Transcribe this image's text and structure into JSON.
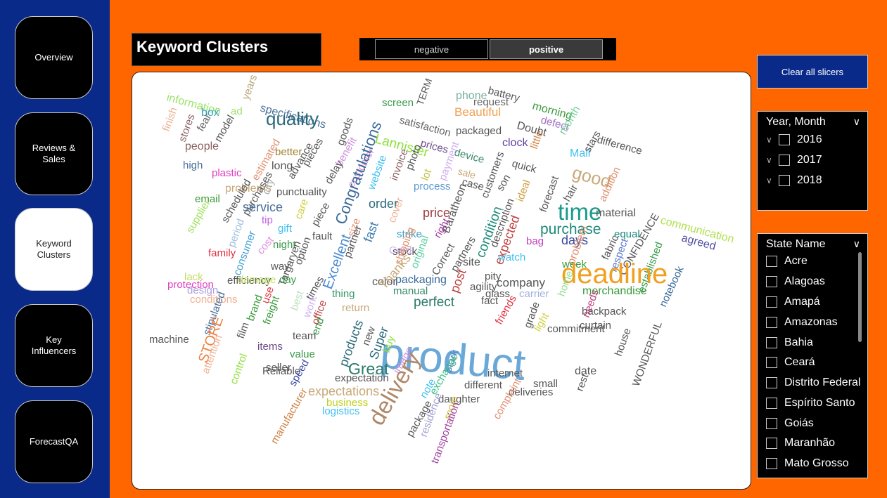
{
  "nav": [
    {
      "label": "Overview"
    },
    {
      "label": "Reviews &\nSales"
    },
    {
      "label": "Keyword\nClusters"
    },
    {
      "label": "Key\nInfluencers"
    },
    {
      "label": "ForecastQA"
    }
  ],
  "title": "Keyword Clusters",
  "sentiment": {
    "negative": "negative",
    "positive": "positive"
  },
  "clear_label": "Clear all slicers",
  "year_slicer": {
    "title": "Year, Month",
    "items": [
      "2016",
      "2017",
      "2018"
    ]
  },
  "state_slicer": {
    "title": "State Name",
    "items": [
      "Acre",
      "Alagoas",
      "Amapá",
      "Amazonas",
      "Bahia",
      "Ceará",
      "Distrito Federal",
      "Espírito Santo",
      "Goiás",
      "Maranhão",
      "Mato Grosso"
    ]
  },
  "word_cloud": [
    {
      "t": "information",
      "s": 16,
      "c": "#9be36b"
    },
    {
      "t": "ad",
      "s": 15,
      "c": "#9be36b"
    },
    {
      "t": "years",
      "s": 15,
      "c": "#b9a27a"
    },
    {
      "t": "specifications",
      "s": 16,
      "c": "#4a6f9a"
    },
    {
      "t": "screen",
      "s": 15,
      "c": "#3a9a4a"
    },
    {
      "t": "TERM",
      "s": 14,
      "c": "#555"
    },
    {
      "t": "phone",
      "s": 16,
      "c": "#7ab0a0"
    },
    {
      "t": "battery",
      "s": 15,
      "c": "#555"
    },
    {
      "t": "request",
      "s": 15,
      "c": "#666"
    },
    {
      "t": "morning",
      "s": 16,
      "c": "#3a9a3a"
    },
    {
      "t": "box",
      "s": 16,
      "c": "#3aa0c0"
    },
    {
      "t": "finish",
      "s": 15,
      "c": "#e8b090"
    },
    {
      "t": "stores",
      "s": 15,
      "c": "#8a6060"
    },
    {
      "t": "fear",
      "s": 15,
      "c": "#666"
    },
    {
      "t": "model",
      "s": 15,
      "c": "#555"
    },
    {
      "t": "quality",
      "s": 26,
      "c": "#2a6a7a"
    },
    {
      "t": "satisfaction",
      "s": 15,
      "c": "#666"
    },
    {
      "t": "Beautiful",
      "s": 17,
      "c": "#f0a050"
    },
    {
      "t": "defect",
      "s": 15,
      "c": "#a070c0"
    },
    {
      "t": "Doubt",
      "s": 16,
      "c": "#555"
    },
    {
      "t": "packaged",
      "s": 15,
      "c": "#555"
    },
    {
      "t": "month",
      "s": 16,
      "c": "#7ad0a0"
    },
    {
      "t": "difference",
      "s": 15,
      "c": "#555"
    },
    {
      "t": "people",
      "s": 16,
      "c": "#8a6060"
    },
    {
      "t": "goods",
      "s": 15,
      "c": "#555"
    },
    {
      "t": "Lannister",
      "s": 19,
      "c": "#90e040"
    },
    {
      "t": "prices",
      "s": 15,
      "c": "#6a4a8a"
    },
    {
      "t": "clock",
      "s": 16,
      "c": "#6040a0"
    },
    {
      "t": "little",
      "s": 15,
      "c": "#d08040"
    },
    {
      "t": "Mail",
      "s": 16,
      "c": "#40c0f0"
    },
    {
      "t": "stars",
      "s": 15,
      "c": "#555"
    },
    {
      "t": "better",
      "s": 15,
      "c": "#a08030"
    },
    {
      "t": "estimated",
      "s": 15,
      "c": "#e09070"
    },
    {
      "t": "pieces",
      "s": 15,
      "c": "#555"
    },
    {
      "t": "benefit",
      "s": 15,
      "c": "#d090e0"
    },
    {
      "t": "device",
      "s": 15,
      "c": "#3a8a6a"
    },
    {
      "t": "high",
      "s": 15,
      "c": "#4a6f9a"
    },
    {
      "t": "plastic",
      "s": 15,
      "c": "#e040c0"
    },
    {
      "t": "long",
      "s": 16,
      "c": "#555"
    },
    {
      "t": "advance",
      "s": 15,
      "c": "#555"
    },
    {
      "t": "website",
      "s": 15,
      "c": "#40c0f0"
    },
    {
      "t": "invoice",
      "s": 15,
      "c": "#8a6060"
    },
    {
      "t": "photo",
      "s": 15,
      "c": "#555"
    },
    {
      "t": "quick",
      "s": 15,
      "c": "#555"
    },
    {
      "t": "good",
      "s": 25,
      "c": "#c8a878"
    },
    {
      "t": "addition",
      "s": 15,
      "c": "#e09070"
    },
    {
      "t": "problems",
      "s": 16,
      "c": "#c8a878"
    },
    {
      "t": "delay",
      "s": 15,
      "c": "#555"
    },
    {
      "t": "customer",
      "s": 15,
      "c": "#e090d0"
    },
    {
      "t": "lot",
      "s": 15,
      "c": "#c0c040"
    },
    {
      "t": "payment",
      "s": 15,
      "c": "#d0b0f0"
    },
    {
      "t": "sale",
      "s": 14,
      "c": "#c8a878"
    },
    {
      "t": "case",
      "s": 15,
      "c": "#555"
    },
    {
      "t": "Congratulations",
      "s": 22,
      "c": "#3a6a9a"
    },
    {
      "t": "process",
      "s": 15,
      "c": "#5a9ad0"
    },
    {
      "t": "son",
      "s": 15,
      "c": "#555"
    },
    {
      "t": "ideal",
      "s": 15,
      "c": "#d0a040"
    },
    {
      "t": "forecast",
      "s": 15,
      "c": "#555"
    },
    {
      "t": "hair",
      "s": 15,
      "c": "#555"
    },
    {
      "t": "time",
      "s": 33,
      "c": "#1a9a8a"
    },
    {
      "t": "material",
      "s": 16,
      "c": "#555"
    },
    {
      "t": "email",
      "s": 15,
      "c": "#3a9a3a"
    },
    {
      "t": "supplier",
      "s": 15,
      "c": "#a0e060"
    },
    {
      "t": "scheduled",
      "s": 15,
      "c": "#555"
    },
    {
      "t": "purchases",
      "s": 15,
      "c": "#555"
    },
    {
      "t": "city",
      "s": 15,
      "c": "#aaa"
    },
    {
      "t": "punctuality",
      "s": 15,
      "c": "#555"
    },
    {
      "t": "order",
      "s": 18,
      "c": "#2a6a7a"
    },
    {
      "t": "customers",
      "s": 15,
      "c": "#555"
    },
    {
      "t": "Baratheon",
      "s": 16,
      "c": "#555"
    },
    {
      "t": "communication",
      "s": 16,
      "c": "#b0e050"
    },
    {
      "t": "service",
      "s": 18,
      "c": "#4a6f9a"
    },
    {
      "t": "care",
      "s": 15,
      "c": "#d0d040"
    },
    {
      "t": "piece",
      "s": 15,
      "c": "#555"
    },
    {
      "t": "cover",
      "s": 15,
      "c": "#f0b090"
    },
    {
      "t": "price",
      "s": 18,
      "c": "#a04040"
    },
    {
      "t": "description",
      "s": 15,
      "c": "#555"
    },
    {
      "t": "purchase",
      "s": 21,
      "c": "#1a8a7a"
    },
    {
      "t": "agreed",
      "s": 16,
      "c": "#5050a0"
    },
    {
      "t": "tip",
      "s": 15,
      "c": "#c060e0"
    },
    {
      "t": "gift",
      "s": 15,
      "c": "#40c0f0"
    },
    {
      "t": "fault",
      "s": 15,
      "c": "#555"
    },
    {
      "t": "size",
      "s": 15,
      "c": "#e09070"
    },
    {
      "t": "fast",
      "s": 18,
      "c": "#3a7ab0"
    },
    {
      "t": "strike",
      "s": 15,
      "c": "#40a0c0"
    },
    {
      "t": "right",
      "s": 15,
      "c": "#a040a0"
    },
    {
      "t": "condition",
      "s": 19,
      "c": "#1a8a7a"
    },
    {
      "t": "expected",
      "s": 18,
      "c": "#c04040"
    },
    {
      "t": "bag",
      "s": 15,
      "c": "#c040c0"
    },
    {
      "t": "days",
      "s": 18,
      "c": "#3a4aa0"
    },
    {
      "t": "equal",
      "s": 15,
      "c": "#1a8a7a"
    },
    {
      "t": "CONFIDENCE",
      "s": 15,
      "c": "#555"
    },
    {
      "t": "period",
      "s": 15,
      "c": "#a0c0e0"
    },
    {
      "t": "night",
      "s": 15,
      "c": "#3a9a4a"
    },
    {
      "t": "Targaryen",
      "s": 15,
      "c": "#555"
    },
    {
      "t": "option",
      "s": 15,
      "c": "#555"
    },
    {
      "t": "stock",
      "s": 15,
      "c": "#555"
    },
    {
      "t": "original",
      "s": 15,
      "c": "#5ad0a0"
    },
    {
      "t": "Correct",
      "s": 15,
      "c": "#555"
    },
    {
      "t": "partners",
      "s": 15,
      "c": "#555"
    },
    {
      "t": "problem",
      "s": 16,
      "c": "#e09070"
    },
    {
      "t": "fabric",
      "s": 15,
      "c": "#555"
    },
    {
      "t": "respect",
      "s": 15,
      "c": "#5a7ad0"
    },
    {
      "t": "established",
      "s": 15,
      "c": "#3a9a4a"
    },
    {
      "t": "family",
      "s": 15,
      "c": "#e03040"
    },
    {
      "t": "consumer",
      "s": 15,
      "c": "#40a0d0"
    },
    {
      "t": "cost",
      "s": 15,
      "c": "#e090e0"
    },
    {
      "t": "partner",
      "s": 15,
      "c": "#555"
    },
    {
      "t": "Card",
      "s": 15,
      "c": "#d0b0f0"
    },
    {
      "t": "shipping",
      "s": 15,
      "c": "#e09070"
    },
    {
      "t": "site",
      "s": 16,
      "c": "#555"
    },
    {
      "t": "watch",
      "s": 15,
      "c": "#40c0f0"
    },
    {
      "t": "week",
      "s": 15,
      "c": "#3a9a3a"
    },
    {
      "t": "deadline",
      "s": 40,
      "c": "#f0a020"
    },
    {
      "t": "lack",
      "s": 15,
      "c": "#c0e060"
    },
    {
      "t": "way",
      "s": 15,
      "c": "#555"
    },
    {
      "t": "efficiency",
      "s": 15,
      "c": "#555"
    },
    {
      "t": "Excellent",
      "s": 20,
      "c": "#4a8ad0"
    },
    {
      "t": "color",
      "s": 16,
      "c": "#555"
    },
    {
      "t": "Thanks",
      "s": 18,
      "c": "#c8a878"
    },
    {
      "t": "packaging",
      "s": 16,
      "c": "#3a6a9a"
    },
    {
      "t": "pity",
      "s": 15,
      "c": "#555"
    },
    {
      "t": "company",
      "s": 17,
      "c": "#555"
    },
    {
      "t": "notebook",
      "s": 15,
      "c": "#3a6a9a"
    },
    {
      "t": "protection",
      "s": 15,
      "c": "#e040c0"
    },
    {
      "t": "day",
      "s": 15,
      "c": "#3a9a4a"
    },
    {
      "t": "times",
      "s": 15,
      "c": "#555"
    },
    {
      "t": "post",
      "s": 18,
      "c": "#c04040"
    },
    {
      "t": "agility",
      "s": 15,
      "c": "#555"
    },
    {
      "t": "merchandise",
      "s": 16,
      "c": "#3a9a3a"
    },
    {
      "t": "design",
      "s": 15,
      "c": "#b0a0e0"
    },
    {
      "t": "damage",
      "s": 15,
      "c": "#c0e060"
    },
    {
      "t": "use",
      "s": 15,
      "c": "#e03040"
    },
    {
      "t": "thing",
      "s": 15,
      "c": "#3a9a6a"
    },
    {
      "t": "manual",
      "s": 15,
      "c": "#3a8a6a"
    },
    {
      "t": "glass",
      "s": 15,
      "c": "#555"
    },
    {
      "t": "carrier",
      "s": 15,
      "c": "#a0b0e0"
    },
    {
      "t": "conditions",
      "s": 15,
      "c": "#f0b090"
    },
    {
      "t": "perfect",
      "s": 19,
      "c": "#2a7a6a"
    },
    {
      "t": "fact",
      "s": 15,
      "c": "#555"
    },
    {
      "t": "home",
      "s": 15,
      "c": "#90e090"
    },
    {
      "t": "backpack",
      "s": 15,
      "c": "#555"
    },
    {
      "t": "stipulated",
      "s": 15,
      "c": "#4a6f9a"
    },
    {
      "t": "brand",
      "s": 15,
      "c": "#3a9a3a"
    },
    {
      "t": "freight",
      "s": 15,
      "c": "#3a9a3a"
    },
    {
      "t": "best",
      "s": 15,
      "c": "#c0e0c0"
    },
    {
      "t": "work",
      "s": 15,
      "c": "#d0b0f0"
    },
    {
      "t": "office",
      "s": 15,
      "c": "#c04040"
    },
    {
      "t": "return",
      "s": 15,
      "c": "#c8a878"
    },
    {
      "t": "product",
      "s": 62,
      "c": "#6aa8d8"
    },
    {
      "t": "friends",
      "s": 15,
      "c": "#e03040"
    },
    {
      "t": "needs",
      "s": 15,
      "c": "#c04080"
    },
    {
      "t": "grade",
      "s": 15,
      "c": "#555"
    },
    {
      "t": "light",
      "s": 15,
      "c": "#d0d040"
    },
    {
      "t": "curtain",
      "s": 15,
      "c": "#555"
    },
    {
      "t": "STORE",
      "s": 20,
      "c": "#f08040"
    },
    {
      "t": "attention",
      "s": 15,
      "c": "#f0b090"
    },
    {
      "t": "film",
      "s": 15,
      "c": "#555"
    },
    {
      "t": "end",
      "s": 15,
      "c": "#3a9a4a"
    },
    {
      "t": "new",
      "s": 15,
      "c": "#555"
    },
    {
      "t": "Super",
      "s": 18,
      "c": "#2a6a7a"
    },
    {
      "t": "commitment",
      "s": 15,
      "c": "#555"
    },
    {
      "t": "machine",
      "s": 15,
      "c": "#555"
    },
    {
      "t": "team",
      "s": 15,
      "c": "#555"
    },
    {
      "t": "products",
      "s": 18,
      "c": "#2a6a7a"
    },
    {
      "t": "buy",
      "s": 15,
      "c": "#90e040"
    },
    {
      "t": "house",
      "s": 15,
      "c": "#555"
    },
    {
      "t": "items",
      "s": 15,
      "c": "#6a4a8a"
    },
    {
      "t": "value",
      "s": 15,
      "c": "#3a9a4a"
    },
    {
      "t": "Great",
      "s": 23,
      "c": "#2a7a6a"
    },
    {
      "t": "image",
      "s": 15,
      "c": "#d090e0"
    },
    {
      "t": "WONDERFUL",
      "s": 15,
      "c": "#555"
    },
    {
      "t": "seller",
      "s": 15,
      "c": "#555"
    },
    {
      "t": "Reliable",
      "s": 15,
      "c": "#555"
    },
    {
      "t": "speed",
      "s": 15,
      "c": "#3a4aa0"
    },
    {
      "t": "expectation",
      "s": 15,
      "c": "#555"
    },
    {
      "t": "Stark",
      "s": 15,
      "c": "#5a7ad0"
    },
    {
      "t": "internet",
      "s": 15,
      "c": "#555"
    },
    {
      "t": "small",
      "s": 15,
      "c": "#555"
    },
    {
      "t": "date",
      "s": 16,
      "c": "#555"
    },
    {
      "t": "control",
      "s": 15,
      "c": "#90e040"
    },
    {
      "t": "delivery",
      "s": 33,
      "c": "#b08868"
    },
    {
      "t": "exchange",
      "s": 15,
      "c": "#3ac080"
    },
    {
      "t": "different",
      "s": 15,
      "c": "#555"
    },
    {
      "t": "deliveries",
      "s": 15,
      "c": "#555"
    },
    {
      "t": "rest",
      "s": 15,
      "c": "#555"
    },
    {
      "t": "expectations",
      "s": 18,
      "c": "#c8a878"
    },
    {
      "t": "note",
      "s": 15,
      "c": "#40c0f0"
    },
    {
      "t": "daughter",
      "s": 15,
      "c": "#555"
    },
    {
      "t": "business",
      "s": 15,
      "c": "#c0d020"
    },
    {
      "t": "logistics",
      "s": 15,
      "c": "#40c0f0"
    },
    {
      "t": "manufacturer",
      "s": 15,
      "c": "#d08040"
    },
    {
      "t": "package",
      "s": 15,
      "c": "#555"
    },
    {
      "t": "residence",
      "s": 15,
      "c": "#a0a0d0"
    },
    {
      "t": "room",
      "s": 15,
      "c": "#d0c040"
    },
    {
      "t": "complaint",
      "s": 15,
      "c": "#e09070"
    },
    {
      "t": "transportation",
      "s": 15,
      "c": "#a040a0"
    }
  ]
}
